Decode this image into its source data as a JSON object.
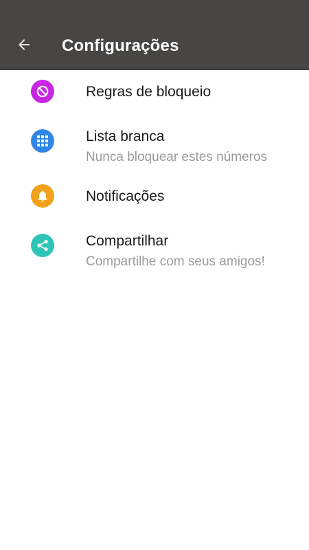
{
  "app_bar": {
    "title": "Configurações",
    "back_icon": "arrow-left-icon",
    "background": "#474645"
  },
  "settings": {
    "items": [
      {
        "title": "Regras de bloqueio",
        "subtitle": "",
        "icon": "block-icon",
        "icon_color": "#c726e3"
      },
      {
        "title": "Lista branca",
        "subtitle": "Nunca bloquear estes números",
        "icon": "grid-icon",
        "icon_color": "#2f86e6"
      },
      {
        "title": "Notificações",
        "subtitle": "",
        "icon": "bell-icon",
        "icon_color": "#f0a21c"
      },
      {
        "title": "Compartilhar",
        "subtitle": "Compartilhe com seus amigos!",
        "icon": "share-icon",
        "icon_color": "#2fc5b6"
      }
    ]
  }
}
